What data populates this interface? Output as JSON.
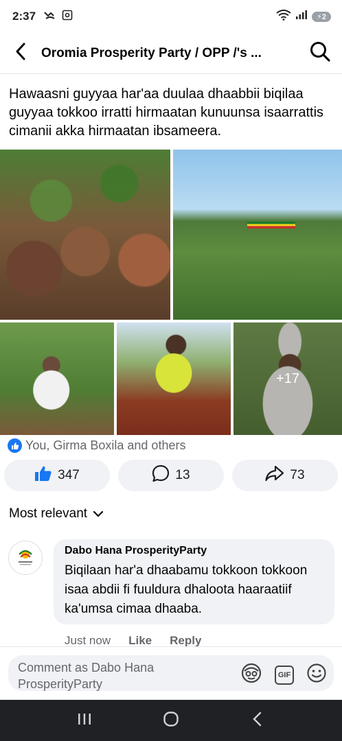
{
  "status_bar": {
    "time": "2:37",
    "battery_label": "2"
  },
  "header": {
    "title": "Oromia Prosperity Party / OPP /'s ..."
  },
  "post": {
    "text": "Hawaasni guyyaa har'aa duulaa dhaabbii biqilaa guyyaa tokkoo irratti hirmaatan kunuunsa isaarrattis cimanii akka hirmaatan ibsameera.",
    "more_photos_label": "+17",
    "reactions_text": "You, Girma Boxila and others"
  },
  "actions": {
    "like_count": "347",
    "comment_count": "13",
    "share_count": "73"
  },
  "sort": {
    "label": "Most relevant"
  },
  "comment": {
    "author": "Dabo Hana ProsperityParty",
    "text": "Biqilaan  har'a dhaabamu tokkoon tokkoon isaa abdii fi fuuldura dhaloota haaraatiif ka'umsa cimaa dhaaba.",
    "time": "Just now",
    "like_label": "Like",
    "reply_label": "Reply"
  },
  "composer": {
    "placeholder": "Comment as Dabo Hana ProsperityParty"
  },
  "colors": {
    "accent": "#1877f2",
    "bubble": "#f0f2f5",
    "navbar": "#1f2124"
  }
}
